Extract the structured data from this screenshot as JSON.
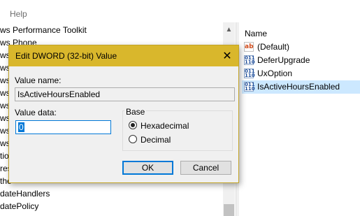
{
  "menubar": {
    "help": "Help"
  },
  "tree": {
    "items": [
      "ws Performance Toolkit",
      "ws Phone",
      "ws",
      "ws",
      "ws",
      "ws",
      "ws",
      "ws",
      "ws",
      "ws",
      "tio",
      "res",
      "the",
      "dateHandlers",
      "datePolicy"
    ]
  },
  "list": {
    "column_name": "Name",
    "rows": [
      {
        "icon": "string-value-icon",
        "glyph": "ab",
        "label": "(Default)"
      },
      {
        "icon": "binary-value-icon",
        "glyph": "011\n110",
        "label": "DeferUpgrade"
      },
      {
        "icon": "binary-value-icon",
        "glyph": "011\n110",
        "label": "UxOption"
      },
      {
        "icon": "binary-value-icon",
        "glyph": "011\n110",
        "label": "IsActiveHoursEnabled"
      }
    ]
  },
  "dialog": {
    "title": "Edit DWORD (32-bit) Value",
    "close_glyph": "✕",
    "value_name_label": "Value name:",
    "value_name": "IsActiveHoursEnabled",
    "value_data_label": "Value data:",
    "value_data": "0",
    "base_label": "Base",
    "base_options": [
      "Hexadecimal",
      "Decimal"
    ],
    "base_selected": "Hexadecimal",
    "ok_label": "OK",
    "cancel_label": "Cancel"
  },
  "colors": {
    "titlebar": "#d9b72c",
    "selection": "#cce8ff",
    "accent": "#0078d7"
  }
}
